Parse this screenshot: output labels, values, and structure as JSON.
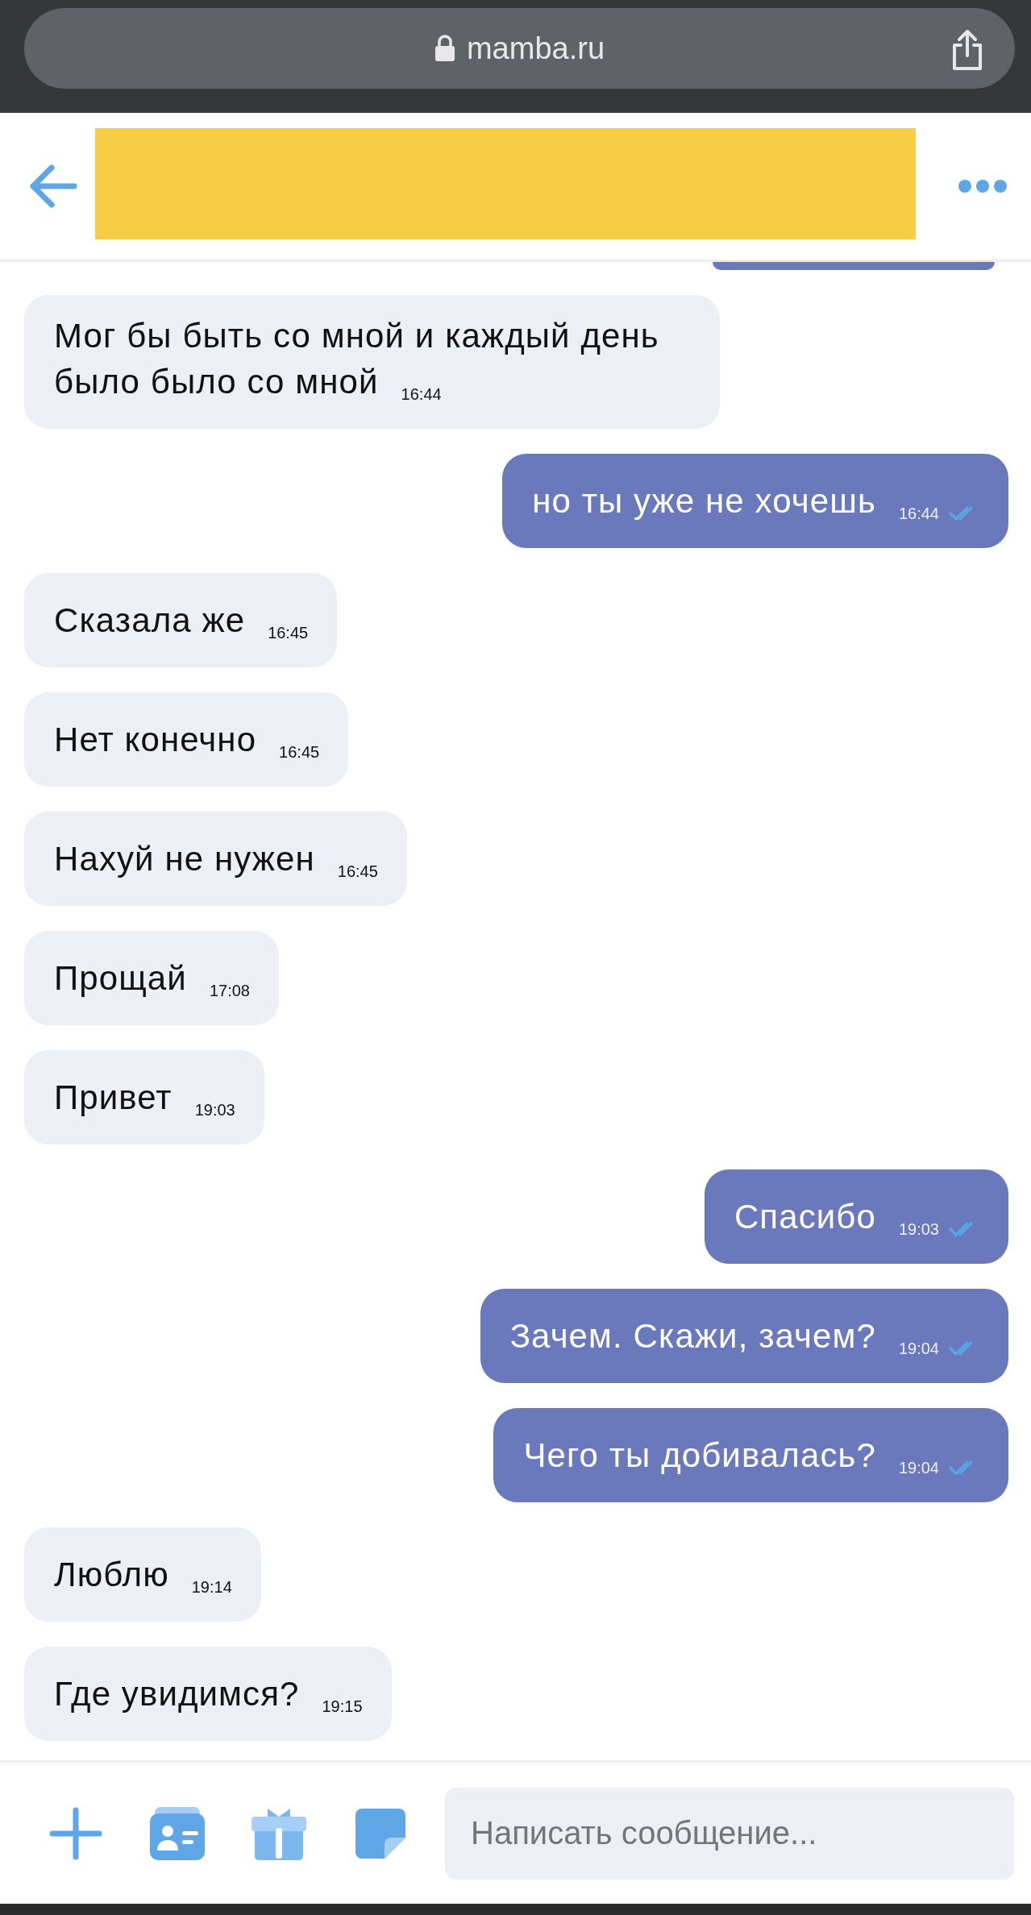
{
  "browser": {
    "address": "mamba.ru"
  },
  "chat": {
    "messages": [
      {
        "kind": "incoming",
        "text": "Мог бы быть со мной и каждый день было было со мной",
        "time": "16:44"
      },
      {
        "kind": "outgoing",
        "text": "но ты уже не хочешь",
        "time": "16:44",
        "read": true
      },
      {
        "kind": "incoming",
        "text": "Сказала же",
        "time": "16:45"
      },
      {
        "kind": "incoming",
        "text": "Нет конечно",
        "time": "16:45"
      },
      {
        "kind": "incoming",
        "text": "Нахуй не нужен",
        "time": "16:45"
      },
      {
        "kind": "incoming",
        "text": "Прощай",
        "time": "17:08"
      },
      {
        "kind": "incoming",
        "text": "Привет",
        "time": "19:03"
      },
      {
        "kind": "outgoing",
        "text": "Спасибо",
        "time": "19:03",
        "read": true
      },
      {
        "kind": "outgoing",
        "text": "Зачем. Скажи, зачем?",
        "time": "19:04",
        "read": true
      },
      {
        "kind": "outgoing",
        "text": "Чего ты добивалась?",
        "time": "19:04",
        "read": true
      },
      {
        "kind": "incoming",
        "text": "Люблю",
        "time": "19:14"
      },
      {
        "kind": "incoming",
        "text": "Где увидимся?",
        "time": "19:15"
      }
    ]
  },
  "composer": {
    "placeholder": "Написать сообщение..."
  }
}
